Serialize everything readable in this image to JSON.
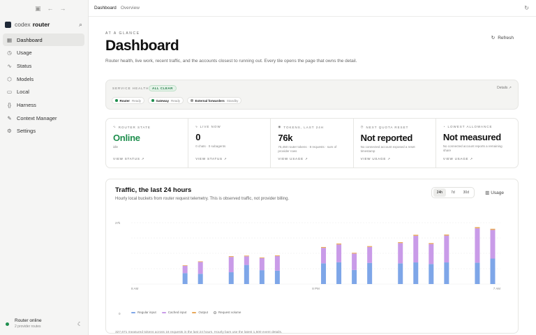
{
  "sidebar": {
    "brand_prefix": "codex",
    "brand_name": "router",
    "items": [
      {
        "label": "Dashboard",
        "icon": "grid-icon"
      },
      {
        "label": "Usage",
        "icon": "clock-icon"
      },
      {
        "label": "Status",
        "icon": "pulse-icon"
      },
      {
        "label": "Models",
        "icon": "cube-icon"
      },
      {
        "label": "Local",
        "icon": "server-icon"
      },
      {
        "label": "Harness",
        "icon": "braces-icon"
      },
      {
        "label": "Context Manager",
        "icon": "pencil-icon"
      },
      {
        "label": "Settings",
        "icon": "gear-icon"
      }
    ],
    "footer": {
      "title": "Router online",
      "subtitle": "2 provider routes"
    }
  },
  "topbar": {
    "crumb_main": "Dashboard",
    "crumb_sub": "Overview"
  },
  "header": {
    "eyebrow": "AT A GLANCE",
    "title": "Dashboard",
    "description": "Router health, live work, recent traffic, and the accounts closest to running out. Every tile opens the page that owns the detail.",
    "refresh_label": "Refresh"
  },
  "health": {
    "label": "SERVICE HEALTH",
    "badge": "ALL CLEAR",
    "details": "Details",
    "services": [
      {
        "name": "Router",
        "status": "Ready",
        "color": "#1f8f4e"
      },
      {
        "name": "Gateway",
        "status": "Ready",
        "color": "#1f8f4e"
      },
      {
        "name": "External forwarders",
        "status": "Standby",
        "color": "#9a9a98"
      }
    ]
  },
  "tiles": [
    {
      "label": "ROUTER STATE",
      "value": "Online",
      "sub": "idle",
      "link": "VIEW STATUS"
    },
    {
      "label": "LIVE NOW",
      "value": "0",
      "sub": "0 chats · 0 subagents",
      "link": "VIEW STATUS"
    },
    {
      "label": "TOKENS, LAST 24H",
      "value": "76k",
      "sub": "76,450 router tokens · 8 requests · sum of provider rows",
      "link": "VIEW USAGE"
    },
    {
      "label": "NEXT QUOTA RESET",
      "value": "Not reported",
      "sub": "No connected account exposed a reset timestamp",
      "link": "VIEW USAGE"
    },
    {
      "label": "LOWEST ALLOWANCE",
      "value": "Not measured",
      "sub": "No connected account reports a remaining share",
      "link": "VIEW USAGE"
    }
  ],
  "traffic": {
    "title": "Traffic, the last 24 hours",
    "subtitle": "Hourly local buckets from router request telemetry. This is observed traffic, not provider billing.",
    "ranges": [
      "24h",
      "7d",
      "30d"
    ],
    "selected_range": "24h",
    "usage_link": "Usage",
    "footer": "327,671 measured tokens across 16 requests in the last 24 hours. Hourly bars use the latest 1,500 event details."
  },
  "chart_data": {
    "type": "bar",
    "stacked": true,
    "y_tick_labels": [
      "27k",
      "0"
    ],
    "ylim": [
      0,
      27000
    ],
    "x_tick_labels": [
      "8 AM",
      "8 PM",
      "7 AM"
    ],
    "categories": [
      "h1",
      "h2",
      "h3",
      "h4",
      "h5",
      "h6",
      "h7",
      "h8",
      "h9",
      "h10",
      "h11",
      "h12",
      "h13",
      "h14",
      "h15",
      "h16",
      "h17",
      "h18",
      "h19",
      "h20",
      "h21",
      "h22",
      "h23",
      "h24"
    ],
    "series": [
      {
        "name": "Regular input",
        "color": "#7ea6e8",
        "values": [
          0,
          0,
          0,
          4800,
          4500,
          0,
          5200,
          8400,
          6100,
          5900,
          0,
          0,
          9100,
          9600,
          6200,
          9300,
          0,
          9100,
          9500,
          8800,
          9500,
          0,
          9400,
          11200
        ]
      },
      {
        "name": "Cached input",
        "color": "#c99be8",
        "values": [
          0,
          0,
          0,
          3200,
          5200,
          0,
          6700,
          3800,
          5300,
          6400,
          0,
          0,
          6800,
          7800,
          7200,
          7000,
          0,
          8900,
          11700,
          8800,
          11800,
          0,
          15100,
          12600
        ]
      },
      {
        "name": "Output",
        "color": "#e8a85a",
        "values": [
          0,
          0,
          0,
          250,
          280,
          0,
          350,
          300,
          300,
          320,
          0,
          0,
          380,
          420,
          350,
          380,
          0,
          420,
          460,
          420,
          460,
          0,
          520,
          500
        ]
      }
    ],
    "legend_extra": "Request volume",
    "grid": true,
    "legend_position": "bottom-left"
  }
}
